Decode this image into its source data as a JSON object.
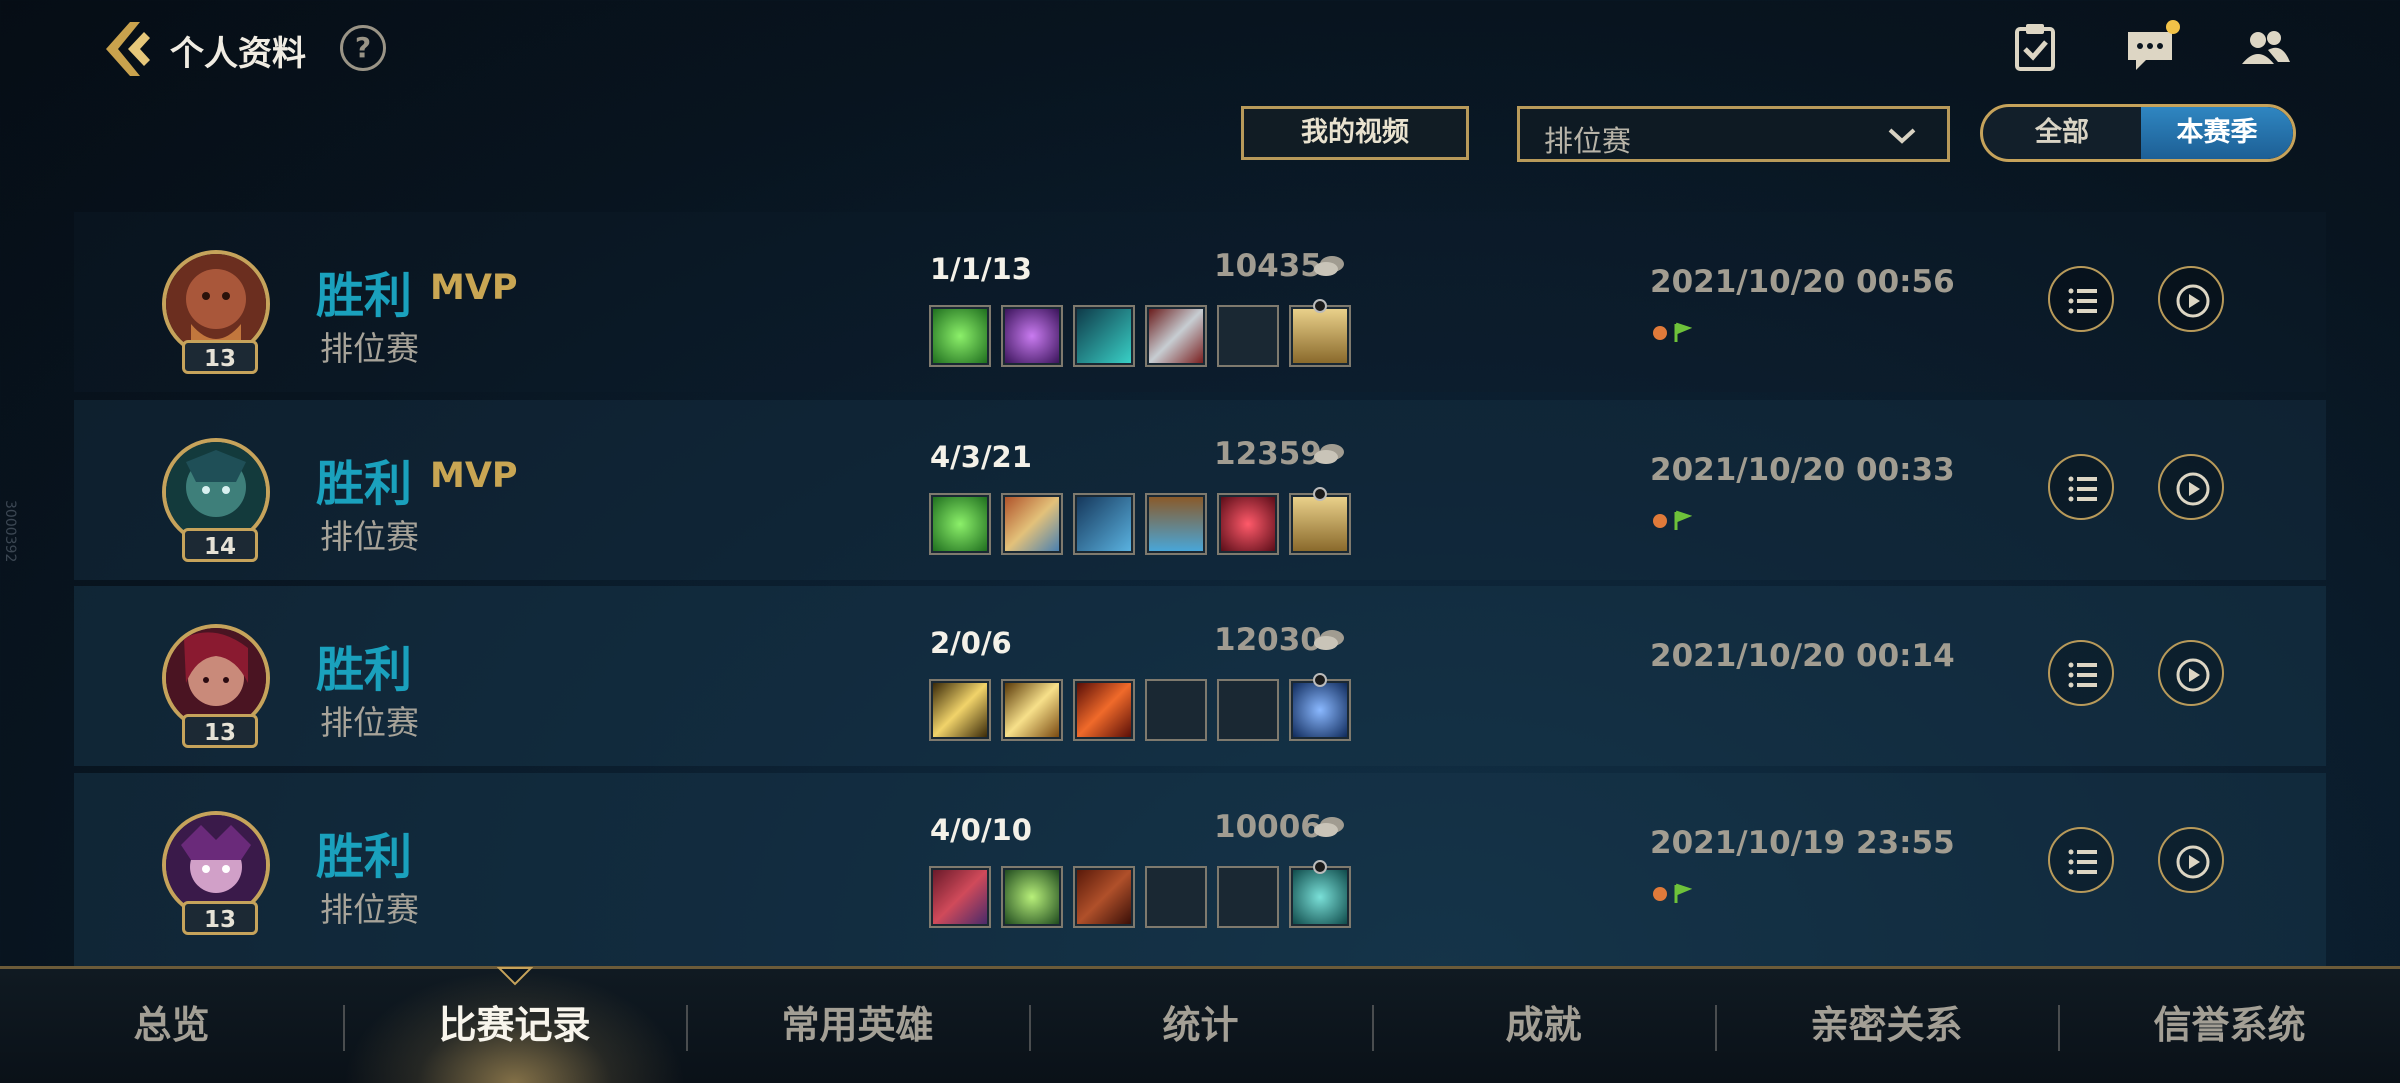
{
  "header": {
    "title": "个人资料",
    "help": "?"
  },
  "filters": {
    "video_label": "我的视频",
    "mode_selected": "排位赛",
    "seg_all": "全部",
    "seg_season": "本赛季"
  },
  "side_id": "3000392",
  "matches": [
    {
      "level": "13",
      "result": "胜利",
      "mvp": "MVP",
      "mode": "排位赛",
      "kda": "1/1/13",
      "gold": "10435",
      "date": "2021/10/20 00:56",
      "tags": true
    },
    {
      "level": "14",
      "result": "胜利",
      "mvp": "MVP",
      "mode": "排位赛",
      "kda": "4/3/21",
      "gold": "12359",
      "date": "2021/10/20 00:33",
      "tags": true
    },
    {
      "level": "13",
      "result": "胜利",
      "mvp": "",
      "mode": "排位赛",
      "kda": "2/0/6",
      "gold": "12030",
      "date": "2021/10/20 00:14",
      "tags": false
    },
    {
      "level": "13",
      "result": "胜利",
      "mvp": "",
      "mode": "排位赛",
      "kda": "4/0/10",
      "gold": "10006",
      "date": "2021/10/19 23:55",
      "tags": true
    }
  ],
  "nav": {
    "tabs": [
      "总览",
      "比赛记录",
      "常用英雄",
      "统计",
      "成就",
      "亲密关系",
      "信誉系统"
    ],
    "active": "比赛记录"
  },
  "colors": {
    "accent_gold": "#c6a35b",
    "win_blue": "#1aa1bd",
    "active_blue": "#2f86c1"
  }
}
